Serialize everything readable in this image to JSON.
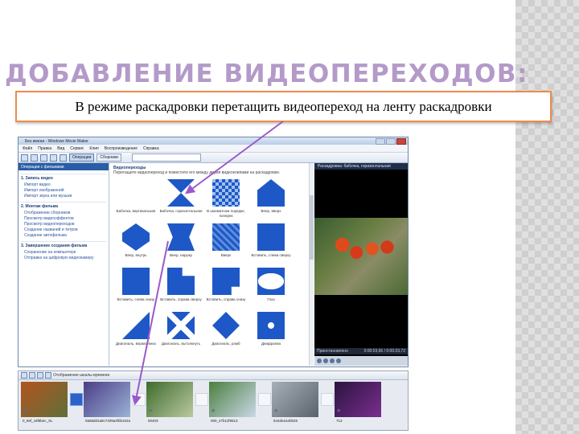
{
  "slide": {
    "title": "ДОБАВЛЕНИЕ ВИДЕОПЕРЕХОДОВ:",
    "callout": "В режиме раскадровки перетащить видеопереход на ленту раскадровки",
    "colors": {
      "title": "#b39ac9",
      "callout_border": "#ef8b4a",
      "arrow": "#9b59c9",
      "transition_blue": "#1e58c7"
    }
  },
  "window": {
    "title": "Без имени - Windows Movie Maker",
    "menu": [
      "Файл",
      "Правка",
      "Вид",
      "Сервис",
      "Клип",
      "Воспроизведение",
      "Справка"
    ],
    "toolbar": {
      "tasks_button": "Операции",
      "collections_button": "Сборники"
    }
  },
  "tasks_panel": {
    "header": "Операции с фильмами",
    "sections": [
      {
        "title": "1. Запись видео",
        "links": [
          "Импорт видео",
          "Импорт изображений",
          "Импорт звука или музыки"
        ]
      },
      {
        "title": "2. Монтаж фильма",
        "links": [
          "Отображение сборников",
          "Просмотр видеоэффектов",
          "Просмотр видеопереходов",
          "Создание названий и титров",
          "Создание автофильма"
        ]
      },
      {
        "title": "3. Завершение создания фильма",
        "links": [
          "Сохранение на компьютере",
          "Отправка на цифровую видеокамеру"
        ]
      }
    ]
  },
  "transitions": {
    "heading": "Видеопереходы",
    "subheading": "Перетащите видеопереход и поместите его между двумя видеоклипами на раскадровке.",
    "items": [
      {
        "label": "Бабочка, вертикальная",
        "icon": "butterfly-vertical"
      },
      {
        "label": "Бабочка, горизонтальная",
        "icon": "butterfly-horizontal",
        "selected": true
      },
      {
        "label": "В шахматном порядке, поперек",
        "icon": "checkerboard"
      },
      {
        "label": "Веер, вверх",
        "icon": "fan-up"
      },
      {
        "label": "Веер, внутрь",
        "icon": "fan-in"
      },
      {
        "label": "Веер, наружу",
        "icon": "fan-out"
      },
      {
        "label": "Вверх",
        "icon": "up"
      },
      {
        "label": "Вставить, слева сверху",
        "icon": "insert-top-left"
      },
      {
        "label": "Вставить, слева снизу",
        "icon": "insert-bottom-left"
      },
      {
        "label": "Вставить, справа сверху",
        "icon": "insert-top-right"
      },
      {
        "label": "Вставить, справа снизу",
        "icon": "insert-bottom-right"
      },
      {
        "label": "Глаз",
        "icon": "eye"
      },
      {
        "label": "Диагональ, вправо вниз",
        "icon": "diagonal-down"
      },
      {
        "label": "Диагональ, вытолкнуть",
        "icon": "diagonal-push"
      },
      {
        "label": "Диагональ, ромб",
        "icon": "diamond"
      },
      {
        "label": "Диафрагма",
        "icon": "iris"
      }
    ]
  },
  "preview": {
    "title": "Раскадровка: бабочка, горизонтальная",
    "status": "Приостановлено",
    "time": "0:00:03,66 / 0:00:23,72"
  },
  "storyboard": {
    "toolbar_label": "Отображение шкалы времени",
    "clips": [
      {
        "label": "0_8ef_c6f9bec_XL",
        "colors": [
          "#b2541e",
          "#5f6f3a"
        ]
      },
      {
        "label": "0a58dd1a8c7409a4f0b102a",
        "colors": [
          "#4a3e86",
          "#9bb2d7"
        ]
      },
      {
        "label": "00403",
        "colors": [
          "#3f6b2c",
          "#b9c9a1"
        ]
      },
      {
        "label": "000_47b11f9513",
        "colors": [
          "#4c7f3f",
          "#c9d8e8"
        ]
      },
      {
        "label": "644dea1ebb25",
        "colors": [
          "#a7afb7",
          "#5a636d"
        ]
      },
      {
        "label": "713",
        "colors": [
          "#2a1440",
          "#7b2e8f"
        ]
      }
    ],
    "tooltip": "Бабочка, горизонтальная"
  }
}
